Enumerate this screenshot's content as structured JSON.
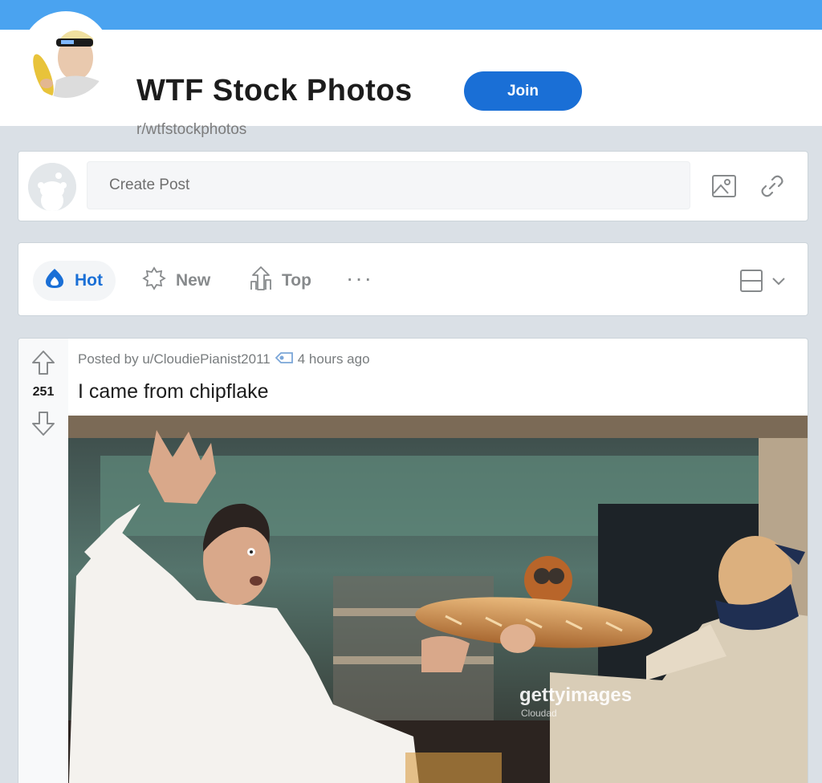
{
  "header": {
    "title": "WTF Stock Photos",
    "subreddit": "r/wtfstockphotos",
    "join_label": "Join"
  },
  "create_post": {
    "placeholder": "Create Post",
    "icons": [
      "image-icon",
      "link-icon"
    ]
  },
  "sort": {
    "items": [
      {
        "label": "Hot",
        "icon": "flame-icon",
        "active": true
      },
      {
        "label": "New",
        "icon": "sparkle-icon",
        "active": false
      },
      {
        "label": "Top",
        "icon": "top-chart-icon",
        "active": false
      }
    ],
    "more": "···"
  },
  "post": {
    "posted_by": "Posted by u/CloudiePianist2011",
    "time": "4 hours ago",
    "title": "I came from chipflake",
    "votes": "251",
    "watermark": "gettyimages",
    "watermark_sub": "Cloudad"
  },
  "colors": {
    "banner": "#4aa3f0",
    "accent": "#1a6fd6",
    "page_bg": "#dae0e6"
  }
}
